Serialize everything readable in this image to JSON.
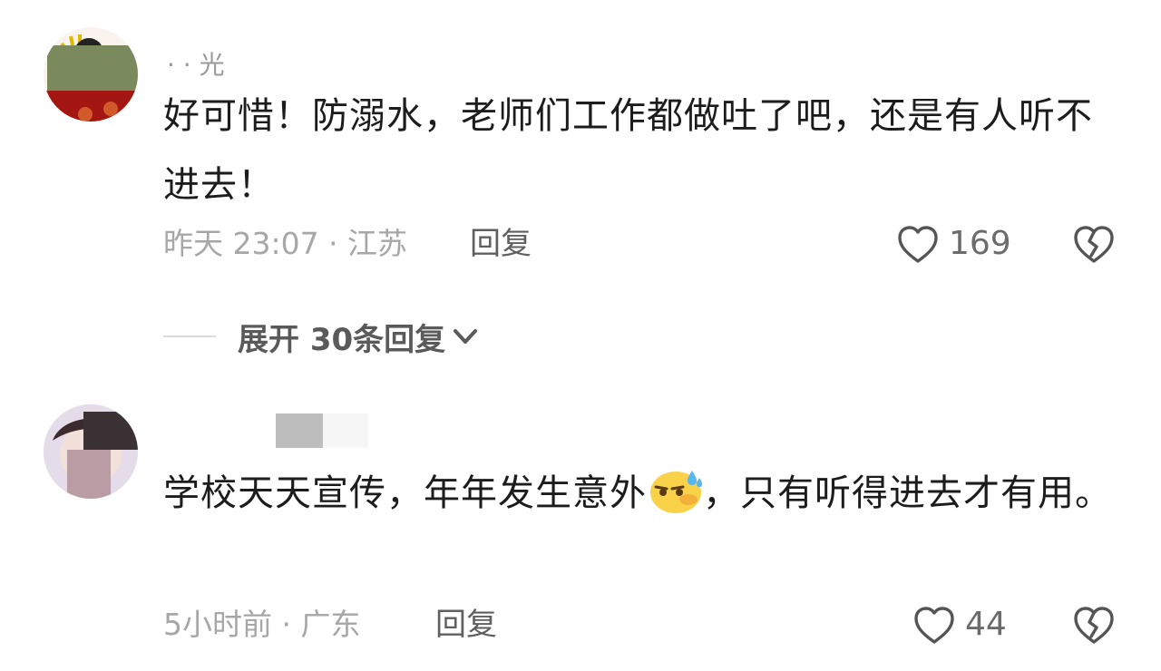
{
  "comments": [
    {
      "username": "· · 光",
      "text": "好可惜！防溺水，老师们工作都做吐了吧，还是有人听不进去！",
      "meta": "昨天 23:07 · 江苏",
      "reply_label": "回复",
      "likes": "169",
      "expand_label": "展开 30条回复"
    },
    {
      "username": "",
      "text_before_emoji": "学校天天宣传，年年发生意外",
      "emoji": "sweating-face-emoji",
      "text_after_emoji": "，只有听得进去才有用。",
      "meta": "5小时前 · 广东",
      "reply_label": "回复",
      "likes": "44"
    }
  ],
  "icons": {
    "like": "heart-outline-icon",
    "dislike": "broken-heart-icon",
    "expand": "chevron-down-icon"
  },
  "colors": {
    "text": "#1c1c1c",
    "meta": "#a7a7a7",
    "reply": "#5f5f5f",
    "icon": "#555555"
  }
}
